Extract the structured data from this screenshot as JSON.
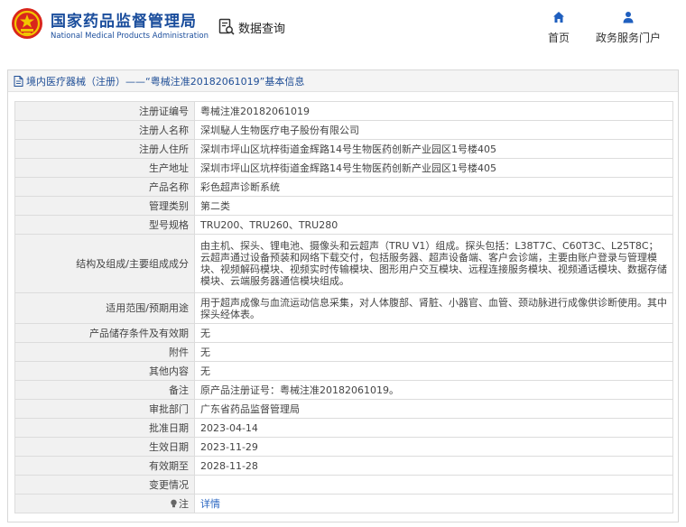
{
  "header": {
    "title_cn": "国家药品监督管理局",
    "title_en": "National Medical Products Administration",
    "query_label": "数据查询",
    "nav": [
      {
        "label": "首页",
        "icon": "home-icon"
      },
      {
        "label": "政务服务门户",
        "icon": "user-icon"
      }
    ]
  },
  "panel": {
    "title": "境内医疗器械（注册）——“粤械注准20182061019”基本信息"
  },
  "details": [
    {
      "key": "注册证编号",
      "value": "粤械注准20182061019"
    },
    {
      "key": "注册人名称",
      "value": "深圳駜人生物医疗电子股份有限公司"
    },
    {
      "key": "注册人住所",
      "value": "深圳市坪山区坑梓街道金辉路14号生物医药创新产业园区1号楼405"
    },
    {
      "key": "生产地址",
      "value": "深圳市坪山区坑梓街道金辉路14号生物医药创新产业园区1号楼405"
    },
    {
      "key": "产品名称",
      "value": "彩色超声诊断系统"
    },
    {
      "key": "管理类别",
      "value": "第二类"
    },
    {
      "key": "型号规格",
      "value": "TRU200、TRU260、TRU280"
    },
    {
      "key": "结构及组成/主要组成成分",
      "value": "由主机、探头、锂电池、摄像头和云超声（TRU V1）组成。探头包括：L38T7C、C60T3C、L25T8C；云超声通过设备预装和网络下载交付，包括服务器、超声设备端、客户会诊端，主要由账户登录与管理模块、视频解码模块、视频实时传输模块、图形用户交互模块、远程连接服务模块、视频通话模块、数据存储模块、云端服务器通信模块组成。"
    },
    {
      "key": "适用范围/预期用途",
      "value": "用于超声成像与血流运动信息采集，对人体腹部、肾脏、小器官、血管、颈动脉进行成像供诊断使用。其中探头经体表。"
    },
    {
      "key": "产品储存条件及有效期",
      "value": "无"
    },
    {
      "key": "附件",
      "value": "无"
    },
    {
      "key": "其他内容",
      "value": "无"
    },
    {
      "key": "备注",
      "value": "原产品注册证号：粤械注准20182061019。"
    },
    {
      "key": "审批部门",
      "value": "广东省药品监督管理局"
    },
    {
      "key": "批准日期",
      "value": "2023-04-14"
    },
    {
      "key": "生效日期",
      "value": "2023-11-29"
    },
    {
      "key": "有效期至",
      "value": "2028-11-28"
    },
    {
      "key": "变更情况",
      "value": ""
    },
    {
      "key": "注",
      "value": "详情"
    }
  ],
  "colors": {
    "brand_blue": "#1a4d9c",
    "logo_red": "#d9261c",
    "logo_gold": "#f2c500",
    "link_blue": "#2966c2"
  }
}
